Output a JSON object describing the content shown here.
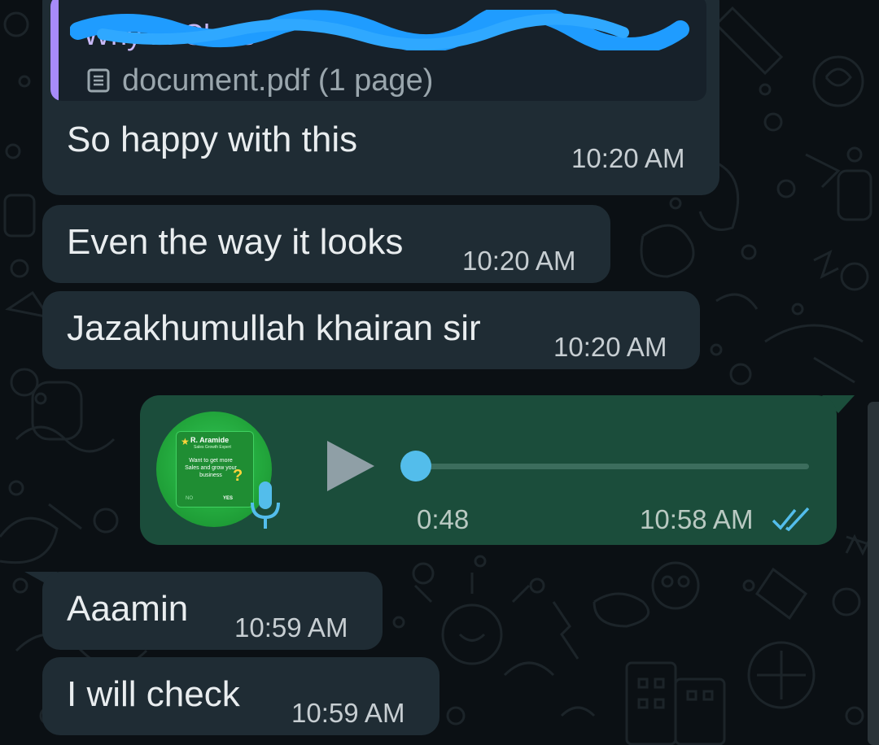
{
  "quoted": {
    "title": "Why ... Class",
    "doc_label": "document.pdf (1 page)",
    "accent_color": "#a78bfa",
    "doc_icon": "document-icon"
  },
  "messages": [
    {
      "text": "So happy with this",
      "time": "10:20 AM"
    },
    {
      "text": "Even the way it looks",
      "time": "10:20 AM"
    },
    {
      "text": "Jazakhumullah khairan sir",
      "time": "10:20 AM"
    }
  ],
  "voice_note": {
    "duration": "0:48",
    "time": "10:58 AM",
    "status_icon": "double-check-icon",
    "play_icon": "play-icon",
    "mic_icon": "microphone-icon",
    "avatar": {
      "name": "R. Aramide",
      "subtitle": "Sales Growth Expert",
      "text": "Want to get more Sales and grow your business",
      "question": "?",
      "no": "NO",
      "yes": "YES"
    },
    "progress": 0,
    "colors": {
      "bubble": "#1b4d3b",
      "knob": "#53bdeb",
      "ticks": "#53bdeb"
    }
  },
  "replies": [
    {
      "text": "Aaamin",
      "time": "10:59 AM"
    },
    {
      "text": "I will check",
      "time": "10:59 AM"
    }
  ],
  "colors": {
    "incoming_bubble": "#1f2c34",
    "background": "#0b1014"
  }
}
